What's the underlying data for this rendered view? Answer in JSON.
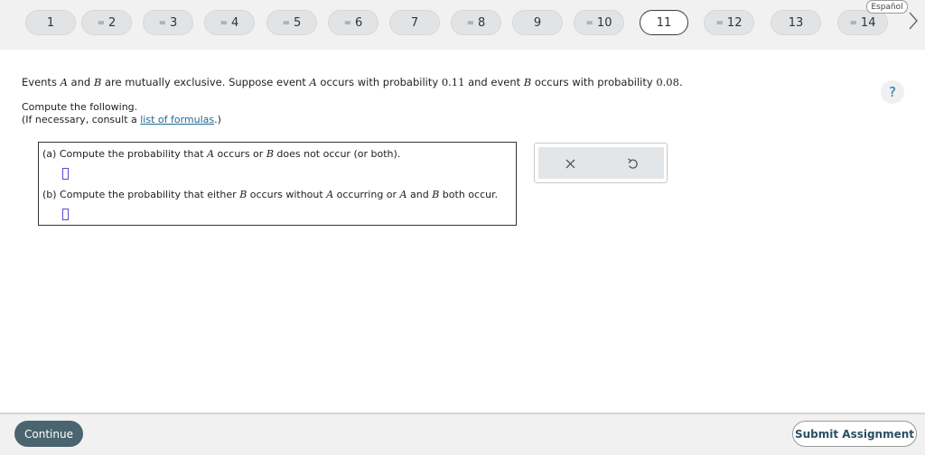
{
  "nav": {
    "questions": [
      {
        "label": "1",
        "answered": false,
        "current": false
      },
      {
        "label": "2",
        "answered": true,
        "current": false
      },
      {
        "label": "3",
        "answered": true,
        "current": false
      },
      {
        "label": "4",
        "answered": true,
        "current": false
      },
      {
        "label": "5",
        "answered": true,
        "current": false
      },
      {
        "label": "6",
        "answered": true,
        "current": false
      },
      {
        "label": "7",
        "answered": false,
        "current": false
      },
      {
        "label": "8",
        "answered": true,
        "current": false
      },
      {
        "label": "9",
        "answered": false,
        "current": false
      },
      {
        "label": "10",
        "answered": true,
        "current": false
      },
      {
        "label": "11",
        "answered": false,
        "current": true
      },
      {
        "label": "12",
        "answered": true,
        "current": false
      },
      {
        "label": "13",
        "answered": false,
        "current": false
      },
      {
        "label": "14",
        "answered": true,
        "current": false
      }
    ],
    "answered_marker": "=",
    "language_label": "Español",
    "next_icon": "chevron-right-icon"
  },
  "help": {
    "label": "?"
  },
  "question": {
    "part1": "Events ",
    "event_a": "A",
    "part2": " and ",
    "event_b": "B",
    "part3": " are mutually exclusive. Suppose event ",
    "part4": " occurs with probability ",
    "prob_a": "0.11",
    "part5": " and event ",
    "part6": " occurs with probability ",
    "prob_b": "0.08",
    "part7": "."
  },
  "compute": {
    "line1": "Compute the following.",
    "line2_prefix": "(If necessary, consult a ",
    "link": "list of formulas",
    "line2_suffix": ".)"
  },
  "parts": {
    "a": {
      "p1": "(a) Compute the probability that ",
      "A": "A",
      "p2": " occurs or ",
      "B": "B",
      "p3": " does not occur (or both)."
    },
    "b": {
      "p1": "(b) Compute the probability that either ",
      "B": "B",
      "p2": " occurs without ",
      "A": "A",
      "p3": " occurring or ",
      "A2": "A",
      "p4": " and ",
      "B2": "B",
      "p5": " both occur."
    }
  },
  "tools": {
    "clear_icon": "close-icon",
    "undo_icon": "undo-icon"
  },
  "footer": {
    "continue": "Continue",
    "submit": "Submit Assignment"
  },
  "colors": {
    "continue_bg": "#4a6570",
    "link": "#1f6a91",
    "cursor": "#6a42d6"
  }
}
